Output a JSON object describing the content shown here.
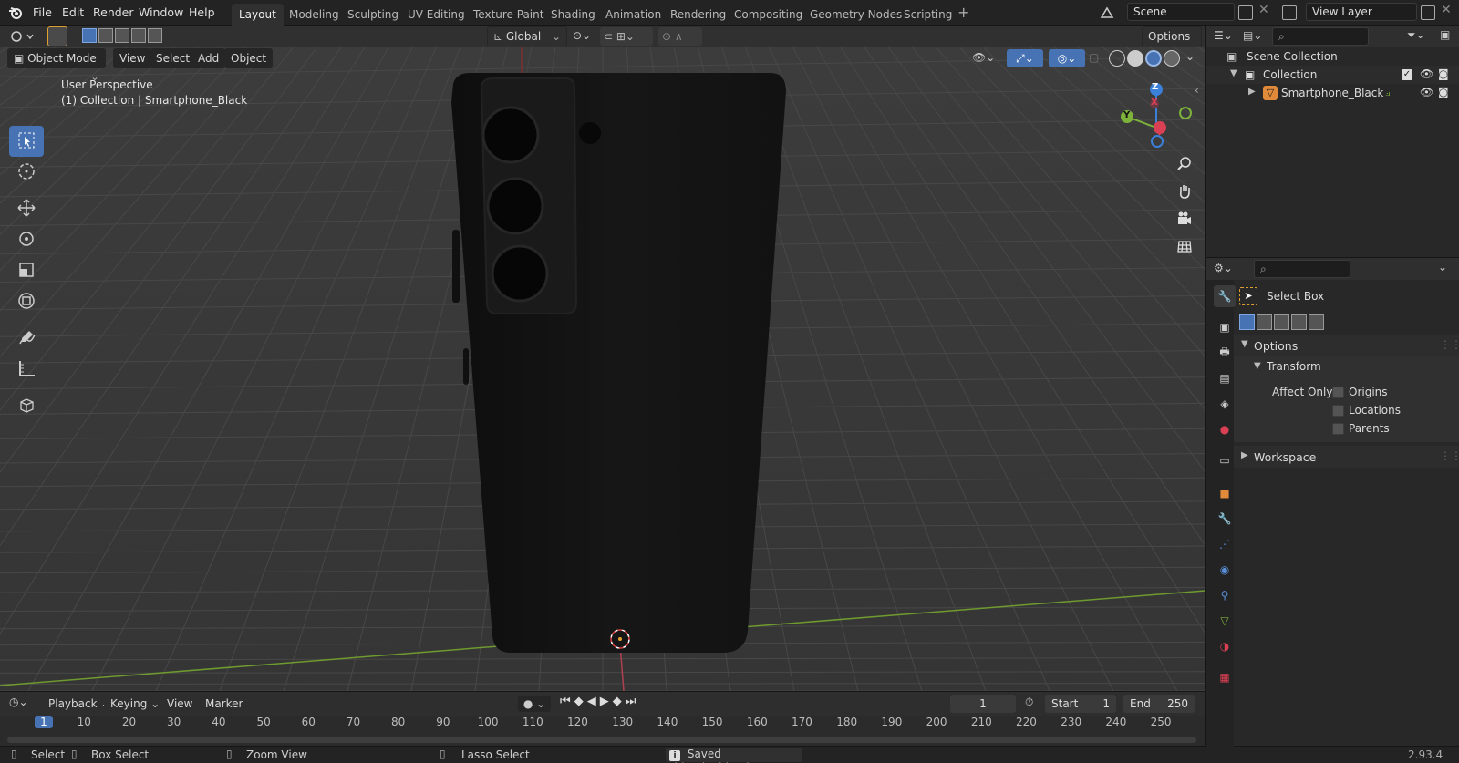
{
  "menu": {
    "file": "File",
    "edit": "Edit",
    "render": "Render",
    "window": "Window",
    "help": "Help"
  },
  "workspaces": [
    "Layout",
    "Modeling",
    "Sculpting",
    "UV Editing",
    "Texture Paint",
    "Shading",
    "Animation",
    "Rendering",
    "Compositing",
    "Geometry Nodes",
    "Scripting"
  ],
  "scene": {
    "name": "Scene",
    "view_layer": "View Layer"
  },
  "viewport_header": {
    "transform_orientation": "Global",
    "options": "Options",
    "mode": "Object Mode",
    "view": "View",
    "select": "Select",
    "add": "Add",
    "object": "Object"
  },
  "viewport_overlay": {
    "perspective": "User Perspective",
    "collection_info": "(1) Collection | Smartphone_Black"
  },
  "gizmo": {
    "z": "Z",
    "y": "Y",
    "x": "X"
  },
  "outliner": {
    "root": "Scene Collection",
    "collection": "Collection",
    "object": "Smartphone_Black"
  },
  "properties": {
    "tool_name": "Select Box",
    "options": "Options",
    "transform": "Transform",
    "affect_only": "Affect Only",
    "origins": "Origins",
    "locations": "Locations",
    "parents": "Parents",
    "workspace": "Workspace"
  },
  "timeline": {
    "playback": "Playback",
    "keying": "Keying",
    "view": "View",
    "marker": "Marker",
    "current_frame": "1",
    "start_label": "Start",
    "start": "1",
    "end_label": "End",
    "end": "250",
    "ticks": [
      "1",
      "10",
      "20",
      "30",
      "40",
      "50",
      "60",
      "70",
      "80",
      "90",
      "100",
      "110",
      "120",
      "130",
      "140",
      "150",
      "160",
      "170",
      "180",
      "190",
      "200",
      "210",
      "220",
      "230",
      "240",
      "250"
    ]
  },
  "status": {
    "select": "Select",
    "box_select": "Box Select",
    "zoom_view": "Zoom View",
    "lasso_select": "Lasso Select",
    "message": "Saved \"blender.blend\"",
    "version": "2.93.4"
  },
  "colors": {
    "accent": "#4772b3",
    "x_axis": "#d94054",
    "y_axis": "#7db33b",
    "z_axis": "#3b80d9",
    "phone": "#141414"
  }
}
